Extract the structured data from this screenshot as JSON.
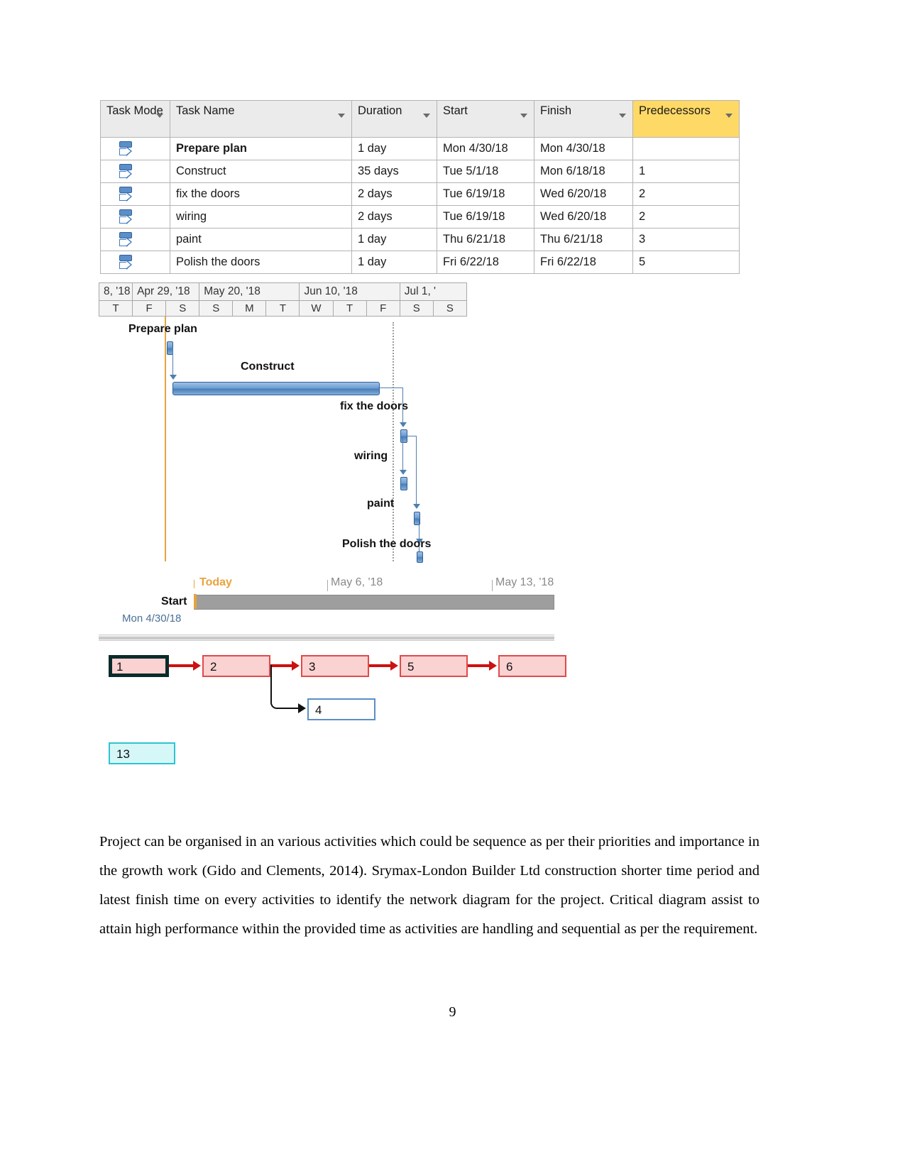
{
  "task_table": {
    "columns": [
      {
        "label": "Task Mode",
        "icon": "filter-arrow-icon"
      },
      {
        "label": "Task Name",
        "icon": "filter-arrow-icon"
      },
      {
        "label": "Duration",
        "icon": "filter-arrow-icon"
      },
      {
        "label": "Start",
        "icon": "filter-arrow-icon"
      },
      {
        "label": "Finish",
        "icon": "filter-arrow-icon"
      },
      {
        "label": "Predecessors",
        "icon": "filter-arrow-icon"
      }
    ],
    "rows": [
      {
        "mode_icon": "auto-schedule-icon",
        "name": "Prepare plan",
        "duration": "1 day",
        "start": "Mon 4/30/18",
        "finish": "Mon 4/30/18",
        "predecessors": ""
      },
      {
        "mode_icon": "auto-schedule-icon",
        "name": "Construct",
        "duration": "35 days",
        "start": "Tue 5/1/18",
        "finish": "Mon 6/18/18",
        "predecessors": "1"
      },
      {
        "mode_icon": "auto-schedule-icon",
        "name": "fix the doors",
        "duration": "2 days",
        "start": "Tue 6/19/18",
        "finish": "Wed 6/20/18",
        "predecessors": "2"
      },
      {
        "mode_icon": "auto-schedule-icon",
        "name": "wiring",
        "duration": "2 days",
        "start": "Tue 6/19/18",
        "finish": "Wed 6/20/18",
        "predecessors": "2"
      },
      {
        "mode_icon": "auto-schedule-icon",
        "name": "paint",
        "duration": "1 day",
        "start": "Thu 6/21/18",
        "finish": "Thu 6/21/18",
        "predecessors": "3"
      },
      {
        "mode_icon": "auto-schedule-icon",
        "name": "Polish the doors",
        "duration": "1 day",
        "start": "Fri 6/22/18",
        "finish": "Fri 6/22/18",
        "predecessors": "5"
      }
    ],
    "header_colors": {
      "default": "#ebebeb",
      "predecessors": "#ffd966"
    }
  },
  "gantt": {
    "timescale_weeks": [
      "8, '18",
      "Apr 29, '18",
      "May 20, '18",
      "Jun 10, '18",
      "Jul 1, '"
    ],
    "timescale_days": [
      "T",
      "F",
      "S",
      "S",
      "M",
      "T",
      "W",
      "T",
      "F",
      "S",
      "S"
    ],
    "bars": [
      {
        "label": "Prepare plan",
        "type": "milestone"
      },
      {
        "label": "Construct",
        "type": "task"
      },
      {
        "label": "fix the doors",
        "type": "milestone"
      },
      {
        "label": "wiring",
        "type": "milestone"
      },
      {
        "label": "paint",
        "type": "milestone"
      },
      {
        "label": "Polish the doors",
        "type": "milestone"
      }
    ],
    "bar_color": "#4a7fb8",
    "today_line_color": "#e8a33d"
  },
  "timeline": {
    "today_label": "Today",
    "ticks": [
      "May 6, '18",
      "May 13, '18"
    ],
    "start_label": "Start",
    "start_date": "Mon 4/30/18",
    "bar_color": "#9e9e9e"
  },
  "network_diagram": {
    "nodes": [
      {
        "id": "1",
        "style": "selected"
      },
      {
        "id": "2",
        "style": "critical"
      },
      {
        "id": "3",
        "style": "critical"
      },
      {
        "id": "5",
        "style": "critical"
      },
      {
        "id": "6",
        "style": "critical"
      },
      {
        "id": "4",
        "style": "noncritical"
      },
      {
        "id": "13",
        "style": "summary"
      }
    ],
    "critical_color": "#cc1111",
    "node_fill": "#fbd2d2",
    "noncritical_border": "#5a8fc4",
    "summary_fill": "#d6f7f8"
  },
  "body": {
    "paragraph": " Project can be organised in an various activities which could be sequence as per their priorities and importance in the growth work (Gido and Clements, 2014).  Srymax-London Builder Ltd construction shorter time period  and latest finish time on every activities to identify the network diagram for the project. Critical diagram assist to attain high performance within the provided time as activities are handling and sequential as per the requirement.",
    "page_number": "9"
  }
}
